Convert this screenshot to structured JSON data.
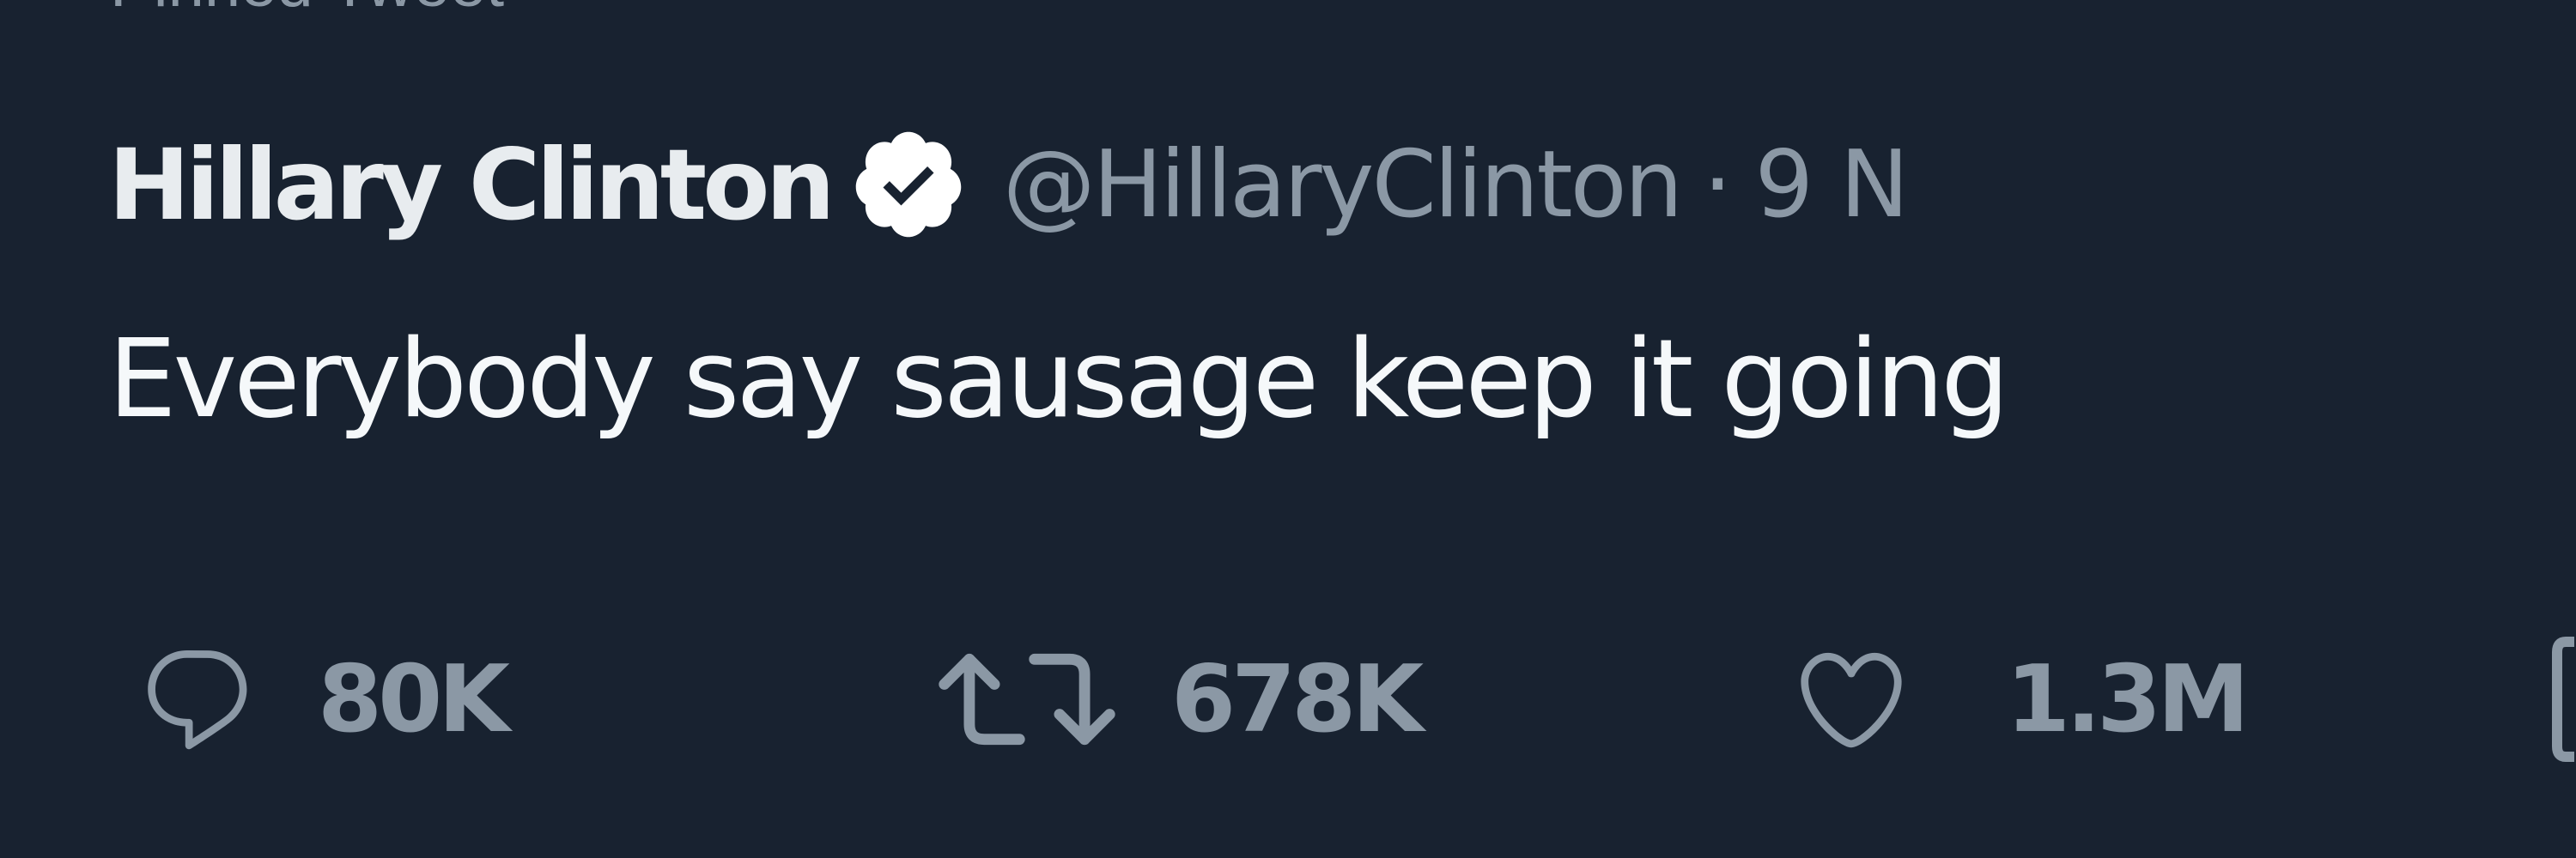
{
  "tweet": {
    "pinned_label": "Pinned Tweet",
    "author": {
      "display_name": "Hillary Clinton",
      "handle": "@HillaryClinton",
      "separator": "·",
      "timestamp": "9 N"
    },
    "text": "Everybody say sausage keep it going",
    "actions": {
      "reply_count": "80K",
      "retweet_count": "678K",
      "like_count": "1.3M"
    }
  },
  "colors": {
    "background": "#182230",
    "primary_text": "#f5f8fa",
    "secondary_text": "#8b98a5",
    "verified_badge": "#ffffff"
  },
  "icons": {
    "verified": "verified-badge-icon",
    "reply": "reply-icon",
    "retweet": "retweet-icon",
    "like": "heart-icon",
    "share": "share-icon"
  }
}
